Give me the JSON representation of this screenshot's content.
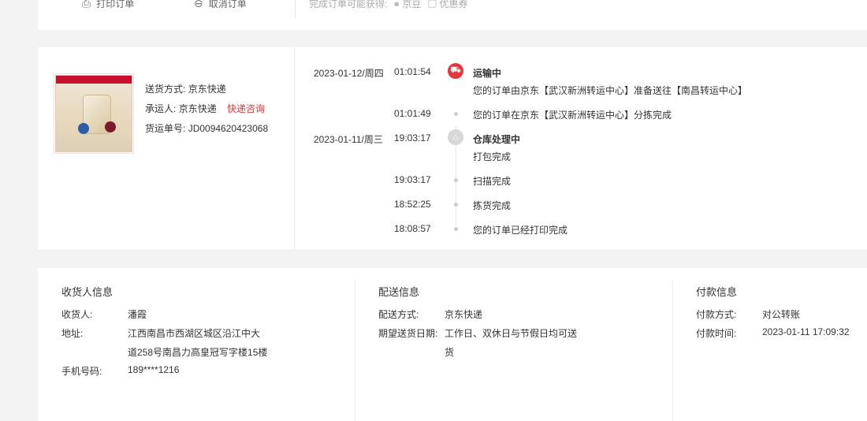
{
  "top": {
    "print_label": "打印订单",
    "cancel_label": "取消订单",
    "rewards_label": "完成订单可能获得:",
    "rewards": [
      "京豆",
      "优惠券"
    ]
  },
  "shipping": {
    "method_label": "送货方式:",
    "method_value": "京东快递",
    "carrier_label": "承运人:",
    "carrier_value": "京东快递",
    "express_link": "快递咨询",
    "tracking_label": "货运单号:",
    "tracking_value": "JD0094620423068"
  },
  "timeline": [
    {
      "date": "2023-01-12/周四",
      "time": "01:01:54",
      "status": "运输中",
      "text": "您的订单由京东【武汉新洲转运中心】准备送往【南昌转运中心】"
    },
    {
      "date": "",
      "time": "01:01:49",
      "status": "",
      "text": "您的订单在京东【武汉新洲转运中心】分拣完成"
    },
    {
      "date": "2023-01-11/周三",
      "time": "19:03:17",
      "status": "仓库处理中",
      "text": "打包完成"
    },
    {
      "date": "",
      "time": "19:03:17",
      "status": "",
      "text": "扫描完成"
    },
    {
      "date": "",
      "time": "18:52:25",
      "status": "",
      "text": "拣货完成"
    },
    {
      "date": "",
      "time": "18:08:57",
      "status": "",
      "text": "您的订单已经打印完成"
    }
  ],
  "receiver": {
    "title": "收货人信息",
    "name_label": "收货人:",
    "name_value": "潘霞",
    "address_label": "地址:",
    "address_line1": "江西南昌市西湖区城区沿江中大",
    "address_line2": "道258号南昌力高皇冠写字楼15楼",
    "phone_label": "手机号码:",
    "phone_value": "189****1216"
  },
  "delivery": {
    "title": "配送信息",
    "method_label": "配送方式:",
    "method_value": "京东快递",
    "date_label": "期望送货日期:",
    "date_line1": "工作日、双休日与节假日均可送",
    "date_line2": "货"
  },
  "payment": {
    "title": "付款信息",
    "method_label": "付款方式:",
    "method_value": "对公转账",
    "time_label": "付款时间:",
    "time_value": "2023-01-11 17:09:32"
  },
  "colors": {
    "accent": "#e4393c",
    "muted": "#cccccc"
  }
}
